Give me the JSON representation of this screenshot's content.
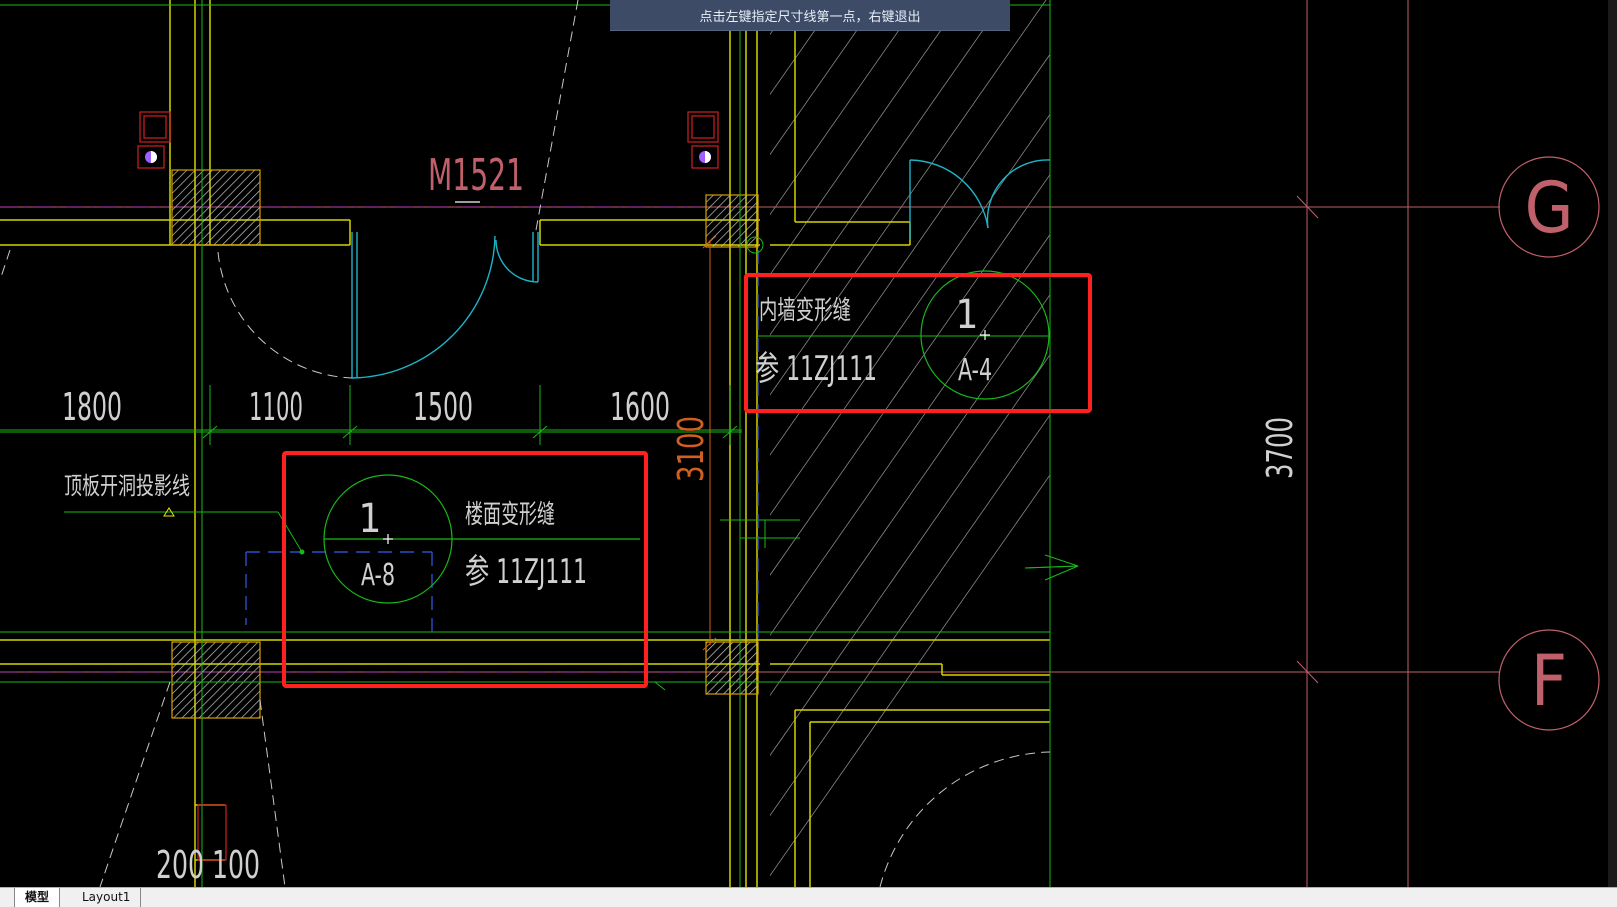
{
  "command_prompt": "点击左键指定尺寸线第一点，右键退出",
  "drawing": {
    "door_label": "M1521",
    "dimensions_top": [
      "1800",
      "1100",
      "1500",
      "1600"
    ],
    "dimension_vertical_left": "3100",
    "dimension_vertical_right": "3700",
    "dimension_bottom": "200 100",
    "grid_axis_top": "G",
    "grid_axis_bottom": "F",
    "note_projection": "顶板开洞投影线",
    "callout_floor": {
      "index": "1",
      "sheet": "A-8",
      "title": "楼面变形缝",
      "reference": "参 11ZJ111"
    },
    "callout_wall": {
      "index": "1",
      "sheet": "A-4",
      "title": "内墙变形缝",
      "reference": "参 11ZJ111"
    }
  },
  "tabs": [
    "模型",
    "Layout1"
  ],
  "colors": {
    "background": "#000000",
    "wall": "#d4d400",
    "axis": "#c0606a",
    "dimension": "#d0d0d0",
    "green": "#19b819",
    "cyan": "#1eb4c8",
    "highlight": "#ff2020"
  }
}
